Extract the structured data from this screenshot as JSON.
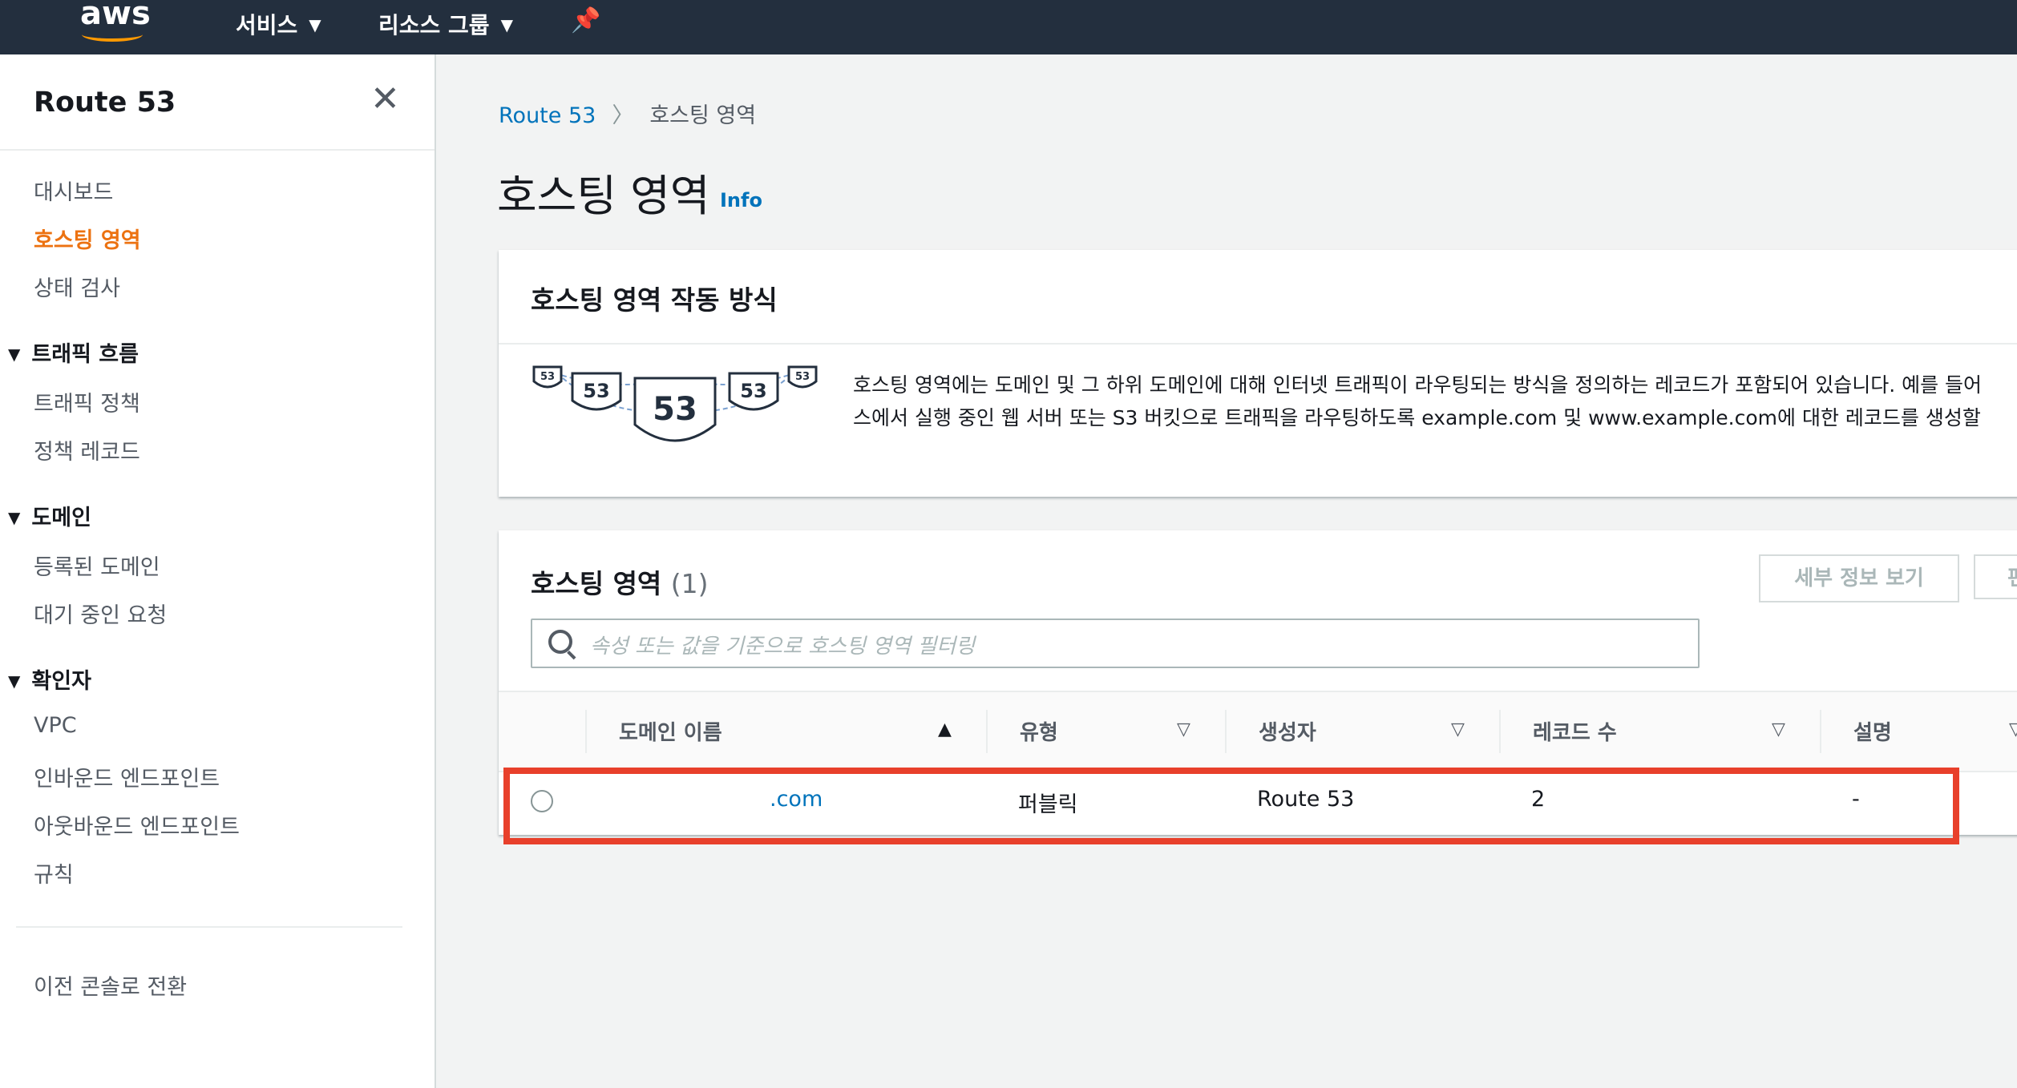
{
  "topbar": {
    "logo": "aws",
    "services_label": "서비스",
    "resource_groups_label": "리소스 그룹"
  },
  "sidebar": {
    "title": "Route 53",
    "items": [
      {
        "label": "대시보드"
      },
      {
        "label": "호스팅 영역",
        "active": true
      },
      {
        "label": "상태 검사"
      }
    ],
    "sections": [
      {
        "heading": "트래픽 흐름",
        "items": [
          "트래픽 정책",
          "정책 레코드"
        ]
      },
      {
        "heading": "도메인",
        "items": [
          "등록된 도메인",
          "대기 중인 요청"
        ]
      },
      {
        "heading": "확인자",
        "items": [
          "VPC",
          "인바운드 엔드포인트",
          "아웃바운드 엔드포인트",
          "규칙"
        ]
      }
    ],
    "footer_link": "이전 콘솔로 전환"
  },
  "breadcrumb": {
    "root": "Route 53",
    "current": "호스팅 영역"
  },
  "page": {
    "title": "호스팅 영역",
    "info": "Info"
  },
  "how_it_works": {
    "title": "호스팅 영역 작동 방식",
    "text_line1": "호스팅 영역에는 도메인 및 그 하위 도메인에 대해 인터넷 트래픽이 라우팅되는 방식을 정의하는 레코드가 포함되어 있습니다. 예를 들어",
    "text_line2": "스에서 실행 중인 웹 서버 또는 S3 버킷으로 트래픽을 라우팅하도록 example.com 및 www.example.com에 대한 레코드를 생성할",
    "illustration": {
      "label": "53"
    }
  },
  "zones": {
    "title": "호스팅 영역",
    "count": "(1)",
    "view_details_button": "세부 정보 보기",
    "edit_button": "편",
    "search_placeholder": "속성 또는 값을 기준으로 호스팅 영역 필터링",
    "columns": [
      "도메인 이름",
      "유형",
      "생성자",
      "레코드 수",
      "설명"
    ],
    "rows": [
      {
        "domain": ".com",
        "type": "퍼블릭",
        "created_by": "Route 53",
        "record_count": "2",
        "description": "-"
      }
    ],
    "highlight_color": "#e8402b"
  },
  "colors": {
    "accent": "#ec7211",
    "link": "#0073bb",
    "topbar": "#232f3e"
  }
}
